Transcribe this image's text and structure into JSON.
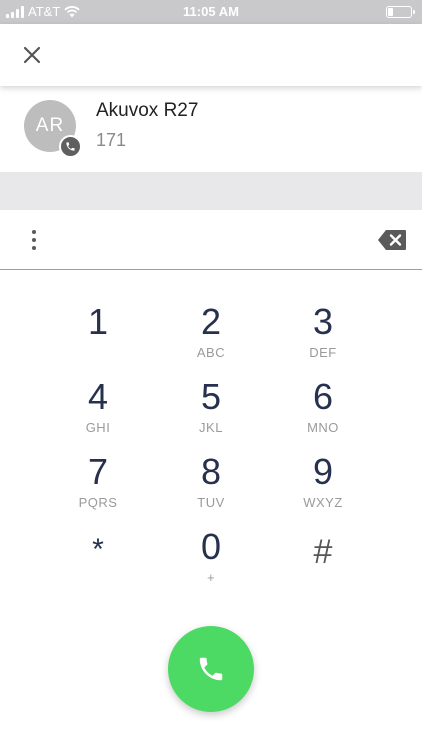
{
  "status_bar": {
    "carrier": "AT&T",
    "time": "11:05 AM"
  },
  "header": {
    "close_icon": "close-icon"
  },
  "contact": {
    "initials": "AR",
    "name": "Akuvox R27",
    "number": "171"
  },
  "dialer": {
    "input_value": "",
    "keys": [
      {
        "digit": "1",
        "letters": ""
      },
      {
        "digit": "2",
        "letters": "ABC"
      },
      {
        "digit": "3",
        "letters": "DEF"
      },
      {
        "digit": "4",
        "letters": "GHI"
      },
      {
        "digit": "5",
        "letters": "JKL"
      },
      {
        "digit": "6",
        "letters": "MNO"
      },
      {
        "digit": "7",
        "letters": "PQRS"
      },
      {
        "digit": "8",
        "letters": "TUV"
      },
      {
        "digit": "9",
        "letters": "WXYZ"
      },
      {
        "digit": "*",
        "letters": ""
      },
      {
        "digit": "0",
        "letters": "+"
      },
      {
        "digit": "#",
        "letters": ""
      }
    ]
  },
  "colors": {
    "call_button": "#4cd964",
    "digit_text": "#27304d",
    "status_bar": "#c9c9cb"
  }
}
